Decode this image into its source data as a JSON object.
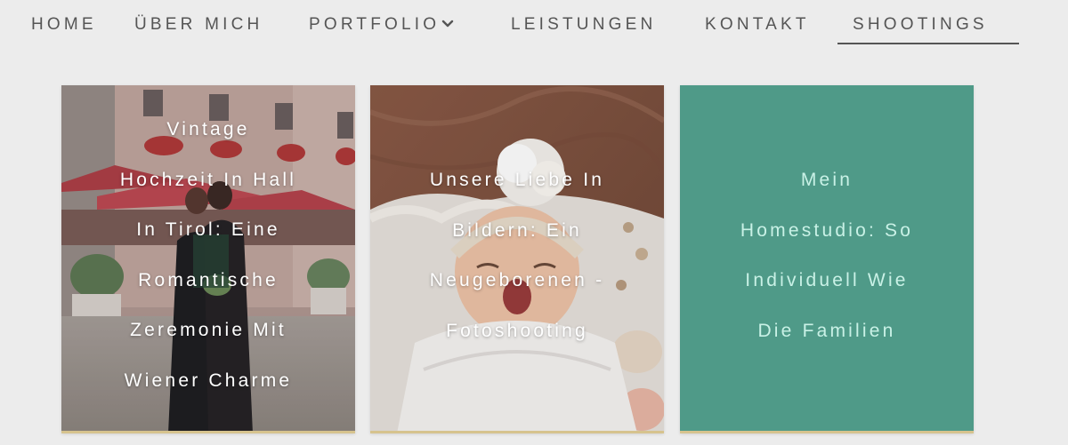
{
  "nav": {
    "items": [
      {
        "label": "HOME"
      },
      {
        "label": "ÜBER MICH"
      },
      {
        "label": "PORTFOLIO",
        "has_dropdown": true
      },
      {
        "label": "LEISTUNGEN"
      },
      {
        "label": "KONTAKT"
      },
      {
        "label": "SHOOTINGS",
        "active": true
      }
    ],
    "dropdown_icon": "chevron-down-icon"
  },
  "cards": [
    {
      "title_lines": [
        "Vintage",
        "Hochzeit In Hall",
        "In Tirol: Eine",
        "Romantische",
        "Zeremonie Mit",
        "Wiener Charme"
      ],
      "image": "wedding-couple-photo"
    },
    {
      "title_lines": [
        "Unsere Liebe In",
        "Bildern: Ein",
        "Neugeborenen -",
        "Fotoshooting"
      ],
      "image": "newborn-baby-photo"
    },
    {
      "title_lines": [
        "Mein",
        "Homestudio: So",
        "Individuell Wie",
        "Die Familien"
      ],
      "background": "#4f9a88"
    }
  ],
  "colors": {
    "page_bg": "#ececec",
    "nav_text": "#555555",
    "teal_card": "#4f9a88",
    "teal_text": "#c9f1e6",
    "card_accent_bar": "#d6c38e"
  }
}
